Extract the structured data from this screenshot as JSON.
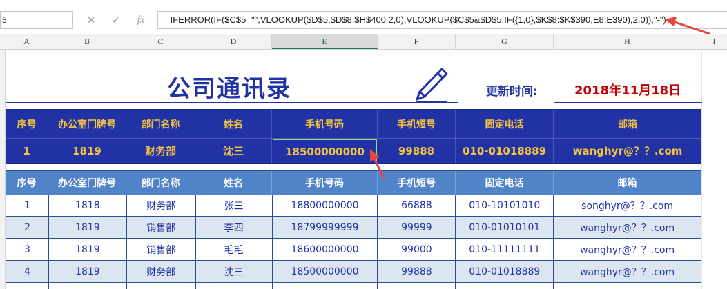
{
  "formula_bar": {
    "name_box": "5",
    "cancel_icon": "✕",
    "enter_icon": "✓",
    "fx_label": "fx",
    "formula": "=IFERROR(IF($C$5=\"\",VLOOKUP($D$5,$D$8:$H$400,2,0),VLOOKUP($C$5&$D$5,IF({1,0},$K$8:$K$390,E8:E390),2,0)),\"-\")"
  },
  "columns": [
    "A",
    "B",
    "C",
    "D",
    "E",
    "F",
    "G",
    "H",
    "I"
  ],
  "selected_column": "E",
  "sheet": {
    "title": "公司通讯录",
    "update_label": "更新时间:",
    "update_value": "2018年11月18日"
  },
  "headers": [
    "序号",
    "办公室门牌号",
    "部门名称",
    "姓名",
    "手机号码",
    "手机短号",
    "固定电话",
    "邮箱"
  ],
  "query_row": [
    "1",
    "1819",
    "财务部",
    "沈三",
    "18500000000",
    "99888",
    "010-01018889",
    "wanghyr@？？.com"
  ],
  "rows": [
    [
      "1",
      "1818",
      "财务部",
      "张三",
      "18800000000",
      "66888",
      "010-10101010",
      "songhyr@？？.com"
    ],
    [
      "2",
      "1819",
      "销售部",
      "李四",
      "18799999999",
      "99999",
      "010-01010101",
      "wanghyr@？？.com"
    ],
    [
      "3",
      "1819",
      "销售部",
      "毛毛",
      "18600000000",
      "99000",
      "010-11111111",
      "wanghyr@？？.com"
    ],
    [
      "4",
      "1819",
      "财务部",
      "沈三",
      "18500000000",
      "99888",
      "010-01018889",
      "wanghyr@？？.com"
    ]
  ],
  "colors": {
    "title_blue": "#2132a4",
    "header_gold": "#f5c342",
    "date_red": "#c00000",
    "data_header_blue": "#5083c7",
    "alt_row": "#dce6f1",
    "arrow_red": "#e8453c"
  }
}
